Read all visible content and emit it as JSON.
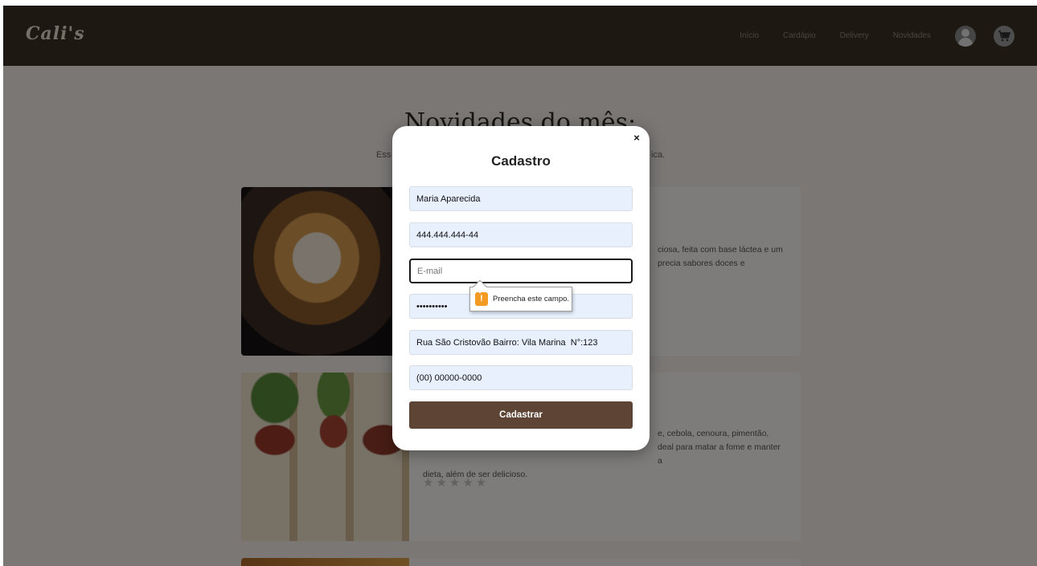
{
  "brand": {
    "logo": "Cali's"
  },
  "nav": {
    "links": [
      "Início",
      "Cardápio",
      "Delivery",
      "Novidades"
    ],
    "user_icon": "user-icon",
    "cart_icon": "cart-icon"
  },
  "page": {
    "title": "Novidades do mês:",
    "subtitle_left": "Ess",
    "subtitle_right": "ica.",
    "cards": [
      {
        "text_line1": "ciosa, feita com base láctea e um",
        "text_line2": "precia sabores doces e"
      },
      {
        "text_line1": "e, cebola, cenoura, pimentão,",
        "text_line2": "deal para matar a fome e manter a",
        "text_line3": "dieta, além de ser delicioso.",
        "stars": "★★★★★"
      }
    ]
  },
  "modal": {
    "title": "Cadastro",
    "close_label": "×",
    "fields": {
      "name": {
        "value": "Maria Aparecida"
      },
      "cpf": {
        "value": "444.444.444-44"
      },
      "email": {
        "value": "",
        "placeholder": "E-mail"
      },
      "password": {
        "value": "••••••••••"
      },
      "address": {
        "value": "Rua São Cristovão Bairro: Vila Marina  N°:123"
      },
      "phone": {
        "value": "(00) 00000-0000"
      }
    },
    "submit_label": "Cadastrar"
  },
  "tooltip": {
    "icon": "!",
    "text": "Preencha este campo."
  },
  "colors": {
    "navbar": "#3a3325",
    "submit_button": "#5d4434",
    "warning": "#f29a22",
    "input_fill": "#e8f0fe"
  }
}
